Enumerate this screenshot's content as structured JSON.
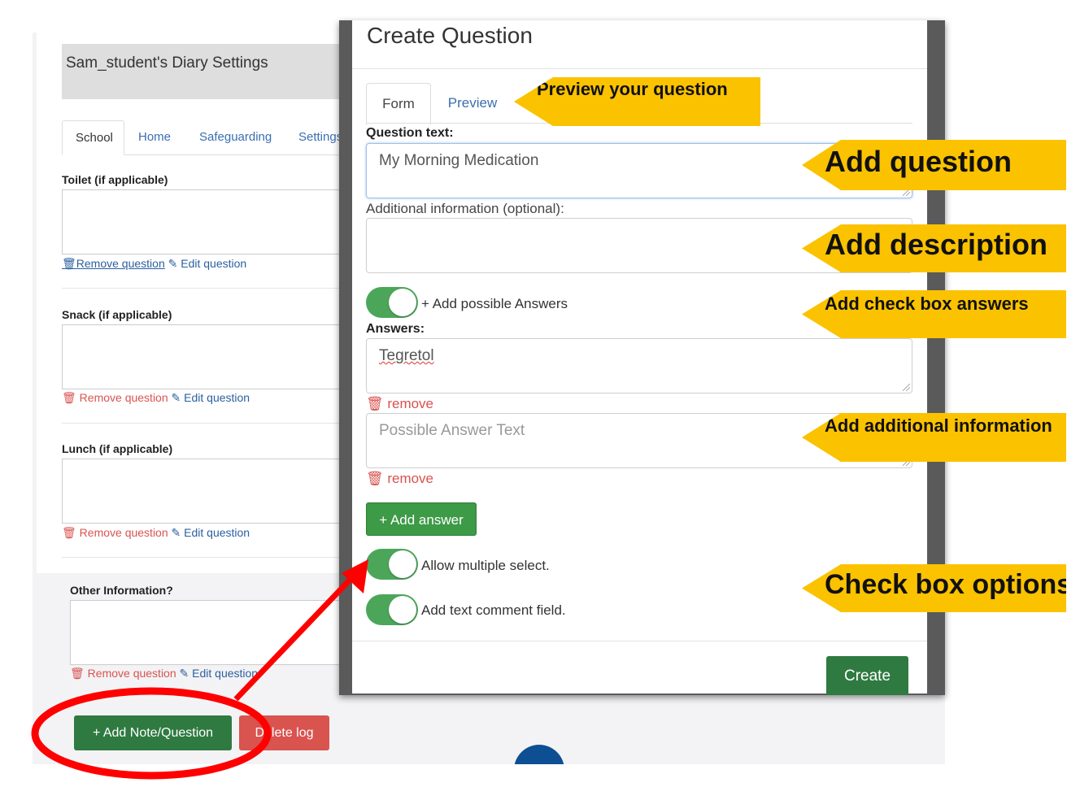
{
  "background": {
    "title": "Sam_student's Diary Settings",
    "tabs": [
      "School",
      "Home",
      "Safeguarding",
      "Settings"
    ],
    "questions": [
      {
        "label": "Toilet (if applicable)",
        "remove": "Remove question",
        "edit": "Edit question"
      },
      {
        "label": "Snack (if applicable)",
        "remove": "Remove question",
        "edit": "Edit question"
      },
      {
        "label": "Lunch (if applicable)",
        "remove": "Remove question",
        "edit": "Edit question"
      },
      {
        "label": "Other Information?",
        "remove": "Remove question",
        "edit": "Edit question"
      }
    ],
    "clipped_fragment": "ti",
    "add_note_button": "+ Add Note/Question",
    "delete_log_button": "Delete log"
  },
  "modal": {
    "title": "Create Question",
    "tabs": {
      "form": "Form",
      "preview": "Preview"
    },
    "question_text_label": "Question text:",
    "question_text_value": "My Morning Medication",
    "additional_info_label": "Additional information (optional):",
    "add_answers_toggle_label": "+ Add possible Answers",
    "answers_label": "Answers:",
    "answers": [
      {
        "value": "Tegretol",
        "remove": "remove"
      },
      {
        "placeholder": "Possible Answer Text",
        "remove": "remove"
      }
    ],
    "add_answer_button": "+ Add answer",
    "allow_multiple_label": "Allow multiple select.",
    "text_comment_label": "Add text comment field.",
    "create_button": "Create",
    "toggles": {
      "add_answers": true,
      "allow_multiple": true,
      "text_comment": true
    }
  },
  "callouts": {
    "preview": "Preview your question",
    "question": "Add question",
    "description": "Add description",
    "checkbox_answers": "Add check box answers",
    "additional_info": "Add additional information",
    "checkbox_options": "Check box options"
  },
  "colors": {
    "callout": "#fbc200",
    "success": "#2f7a41",
    "danger": "#d9534f",
    "link": "#3a6fb0",
    "toggle_on": "#4ca65a",
    "annotation": "#ff0000"
  }
}
